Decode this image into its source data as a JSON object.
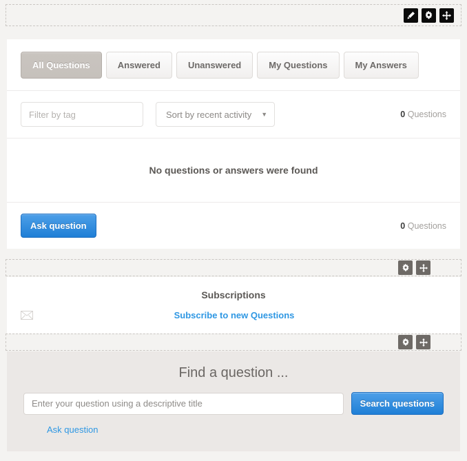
{
  "toolbars": {
    "top": {
      "buttons": [
        {
          "name": "edit-icon",
          "label": "Edit",
          "style": "dark"
        },
        {
          "name": "gear-icon",
          "label": "Settings",
          "style": "dark"
        },
        {
          "name": "move-icon",
          "label": "Move",
          "style": "dark"
        }
      ]
    },
    "middle": {
      "buttons": [
        {
          "name": "gear-icon",
          "label": "Settings",
          "style": "gray"
        },
        {
          "name": "move-icon",
          "label": "Move",
          "style": "gray"
        }
      ]
    },
    "bottom": {
      "buttons": [
        {
          "name": "gear-icon",
          "label": "Settings",
          "style": "gray"
        },
        {
          "name": "move-icon",
          "label": "Move",
          "style": "gray"
        }
      ]
    }
  },
  "questions_panel": {
    "tabs": [
      {
        "label": "All Questions",
        "active": true
      },
      {
        "label": "Answered",
        "active": false
      },
      {
        "label": "Unanswered",
        "active": false
      },
      {
        "label": "My Questions",
        "active": false
      },
      {
        "label": "My Answers",
        "active": false
      }
    ],
    "tag_filter_placeholder": "Filter by tag",
    "tag_filter_value": "",
    "sort_selected": "Sort by recent activity",
    "sort_caret": "▼",
    "count_top_number": "0",
    "count_top_label": "Questions",
    "empty_message": "No questions or answers were found",
    "ask_button_label": "Ask question",
    "count_bottom_number": "0",
    "count_bottom_label": "Questions"
  },
  "subscriptions": {
    "title": "Subscriptions",
    "envelope_icon": "envelope-icon",
    "link_label": "Subscribe to new Questions"
  },
  "find": {
    "title": "Find a question ...",
    "input_placeholder": "Enter your question using a descriptive title",
    "input_value": "",
    "search_button_label": "Search questions",
    "ask_link_label": "Ask question"
  },
  "colors": {
    "accent_blue": "#2e97e3",
    "page_bg": "#f4f3f1",
    "panel_bg": "#ebe8e6",
    "active_tab": "#c6c1bc"
  }
}
